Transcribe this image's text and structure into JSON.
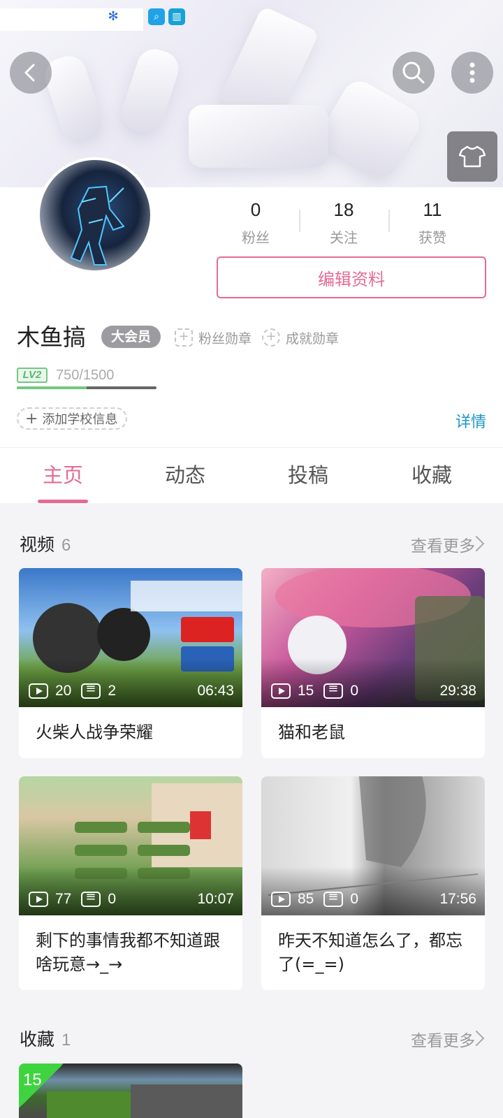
{
  "header": {
    "back_icon": "back-arrow-icon",
    "search_icon": "search-icon",
    "more_icon": "more-vertical-icon",
    "skin_icon": "tshirt-icon"
  },
  "profile": {
    "stats": [
      {
        "value": "0",
        "label": "粉丝"
      },
      {
        "value": "18",
        "label": "关注"
      },
      {
        "value": "11",
        "label": "获赞"
      }
    ],
    "edit_button": "编辑资料",
    "username": "木鱼搞",
    "vip_badge": "大会员",
    "fan_medal": "粉丝勋章",
    "achievement_medal": "成就勋章",
    "level": "LV2",
    "exp_text": "750/1500",
    "exp_progress": 0.5,
    "add_school": "添加学校信息",
    "detail_link": "详情"
  },
  "tabs": [
    "主页",
    "动态",
    "投稿",
    "收藏"
  ],
  "videos": {
    "title": "视频",
    "count": "6",
    "more": "查看更多",
    "items": [
      {
        "title": "火柴人战争荣耀",
        "plays": "20",
        "danmaku": "2",
        "duration": "06:43"
      },
      {
        "title": "猫和老鼠",
        "plays": "15",
        "danmaku": "0",
        "duration": "29:38"
      },
      {
        "title": "剩下的事情我都不知道跟啥玩意→_→",
        "plays": "77",
        "danmaku": "0",
        "duration": "10:07"
      },
      {
        "title": "昨天不知道怎么了，都忘了(=_=)",
        "plays": "85",
        "danmaku": "0",
        "duration": "17:56"
      }
    ]
  },
  "favorites": {
    "title": "收藏",
    "count": "1",
    "more": "查看更多",
    "thumb_badge": "15"
  },
  "colors": {
    "accent": "#e46b94",
    "link": "#1c95c8",
    "level_green": "#74c783"
  }
}
